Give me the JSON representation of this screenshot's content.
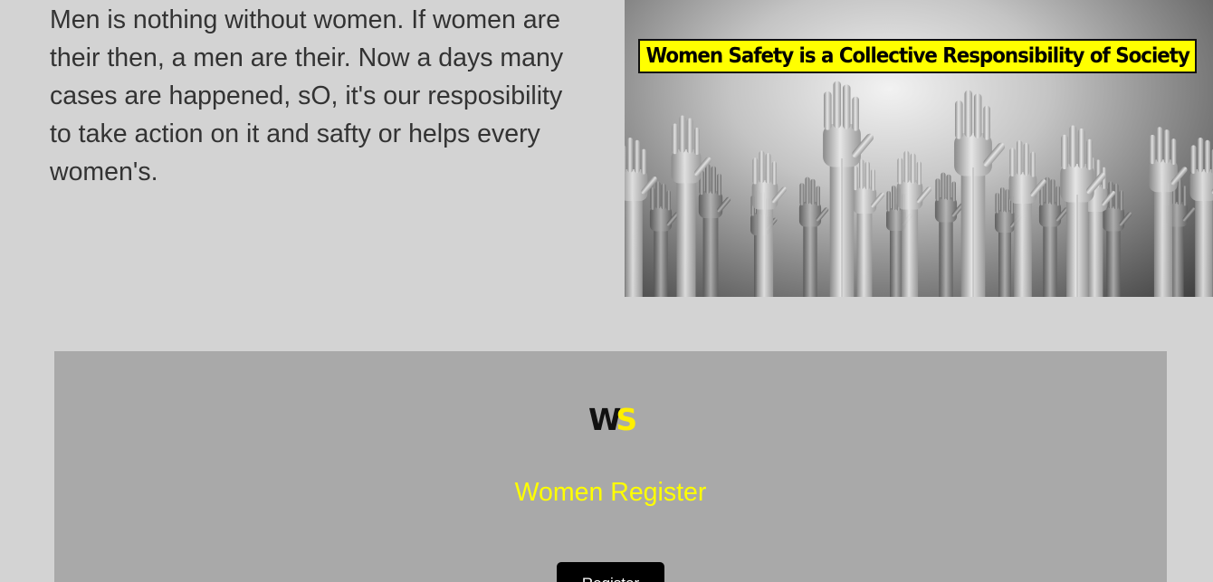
{
  "intro": {
    "paragraph": "Men is nothing without women. If women are their then, a men are their. Now a days many cases are happened, sO, it's our resposibility to take action on it and safty or helps every women's."
  },
  "hero": {
    "banner_text": "Women Safety is a Collective Responsibility of Society",
    "image_subject": "raised-hands-photo",
    "banner_color": "#ffff00"
  },
  "register": {
    "logo_w": "W",
    "logo_s": "S",
    "title": "Women Register",
    "button_label": "Register",
    "title_color": "#ffff00",
    "panel_color": "#a9a9a9"
  }
}
